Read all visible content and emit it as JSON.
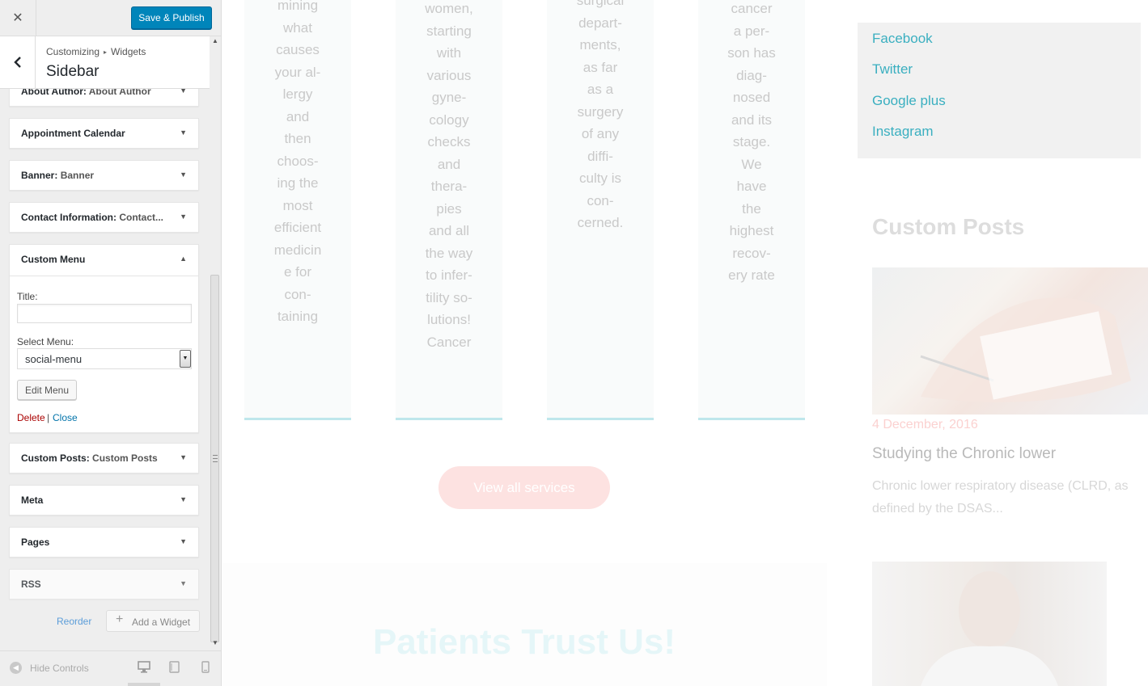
{
  "customizer": {
    "close_icon": "close-icon",
    "publish_label": "Save & Publish",
    "breadcrumb": {
      "root": "Customizing",
      "separator": "▸",
      "current": "Widgets"
    },
    "section_title": "Sidebar",
    "widgets": [
      {
        "title": "About Author",
        "subtitle": "About Author"
      },
      {
        "title": "Appointment Calendar",
        "subtitle": ""
      },
      {
        "title": "Banner",
        "subtitle": "Banner"
      },
      {
        "title": "Contact Information",
        "subtitle": "Contact..."
      },
      {
        "title": "Custom Menu",
        "subtitle": "",
        "expanded": true
      },
      {
        "title": "Custom Posts",
        "subtitle": "Custom Posts"
      },
      {
        "title": "Meta",
        "subtitle": ""
      },
      {
        "title": "Pages",
        "subtitle": ""
      },
      {
        "title": "RSS",
        "subtitle": ""
      }
    ],
    "custom_menu": {
      "title_label": "Title:",
      "title_value": "",
      "select_label": "Select Menu:",
      "select_value": "social-menu",
      "edit_button": "Edit Menu",
      "delete_link": "Delete",
      "link_separator": "|",
      "close_link": "Close"
    },
    "reorder_label": "Reorder",
    "add_widget_label": "Add a Widget",
    "hide_controls_label": "Hide Controls"
  },
  "preview": {
    "services": [
      "mining\nwhat\ncauses\nyour al-\nlergy\nand\nthen\nchoos-\ning the\nmost\nefficient\nmedicin\ne for\ncon-\ntaining",
      "women,\nstarting\nwith\nvarious\ngyne-\ncology\nchecks\nand\nthera-\npies\nand all\nthe way\nto infer-\ntility so-\nlutions!\nCancer",
      "surgical\ndepart-\nments,\nas far\nas a\nsurgery\nof any\ndiffi-\nculty is\ncon-\ncerned.",
      "cancer\na per-\nson has\ndiag-\nnosed\nand its\nstage.\nWe\nhave\nthe\nhighest\nrecov-\nery rate"
    ],
    "view_all_label": "View all services",
    "patients_title": "Patients Trust Us!",
    "social_links": [
      "Facebook",
      "Twitter",
      "Google plus",
      "Instagram"
    ],
    "custom_posts_title": "Custom Posts",
    "post": {
      "date": "4 December, 2016",
      "title": "Studying the Chronic lower",
      "excerpt": "Chronic lower respiratory disease (CLRD, as defined by the DSAS..."
    }
  },
  "colors": {
    "publish": "#0085ba",
    "link_teal": "#3aafc0",
    "delete": "#aa0000",
    "close_link": "#0073aa"
  }
}
